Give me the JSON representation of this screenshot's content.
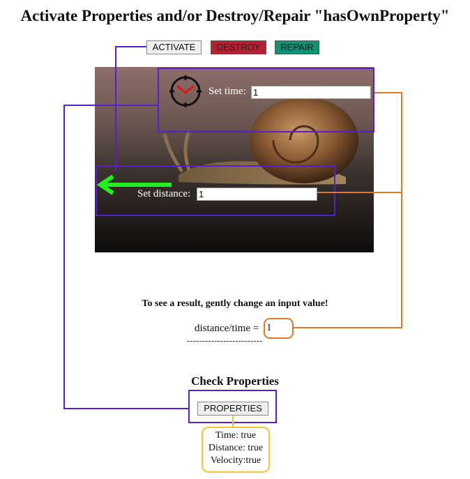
{
  "header": {
    "title": "Activate Properties and/or Destroy/Repair \"hasOwnProperty\""
  },
  "toolbar": {
    "activate_label": "ACTIVATE",
    "destroy_label": "DESTROY",
    "repair_label": "REPAIR"
  },
  "colors": {
    "destroy": "#b32134",
    "repair": "#119176",
    "connector_purple": "#5a1fc8",
    "connector_orange": "#e0782a",
    "result_border": "#f4c430",
    "arrow": "#22ee22",
    "clock": "#e01414"
  },
  "image": {
    "subject_icon": "snail-photo"
  },
  "time_input": {
    "label": "Set time:",
    "value": "1",
    "icon": "clock-icon"
  },
  "distance_input": {
    "label": "Set distance:",
    "value": "1",
    "icon": "green-left-arrow-icon"
  },
  "result": {
    "hint": "To see a result, gently change an input value!",
    "label": "distance/time =",
    "value": "1",
    "separator": "-------------------------"
  },
  "check": {
    "title": "Check Properties",
    "button_label": "PROPERTIES",
    "lines": [
      "Time: true",
      "Distance: true",
      "Velocity:true"
    ]
  }
}
